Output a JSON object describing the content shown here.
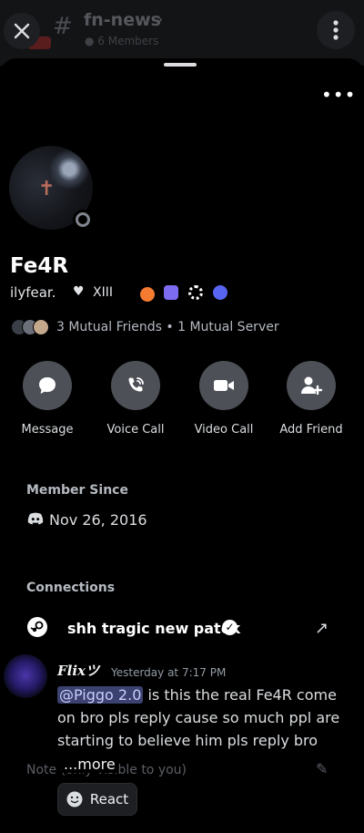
{
  "channel": {
    "hash_glyph": "#",
    "name": "fn-news",
    "chevron": "›",
    "member_count": "● 6 Members"
  },
  "sheet": {
    "more_glyph": "•••"
  },
  "profile": {
    "display_name": "Fe4R",
    "username": "ilyfear.",
    "heart_glyph": "♥",
    "clan_tag": "XIII",
    "mutual_text": "3 Mutual Friends  •  1 Mutual Server",
    "actions": [
      {
        "label": "Message",
        "icon": "message-bubble-icon"
      },
      {
        "label": "Voice Call",
        "icon": "phone-icon"
      },
      {
        "label": "Video Call",
        "icon": "video-camera-icon"
      },
      {
        "label": "Add Friend",
        "icon": "add-friend-icon"
      }
    ],
    "member_since_label": "Member Since",
    "member_since_date": "Nov 26, 2016",
    "connections_label": "Connections",
    "connection_name": "shh tragic new patek",
    "note_label": "Note (only visible to you)"
  },
  "message": {
    "author": "Flixツ",
    "timestamp": "Yesterday at 7:17 PM",
    "mention": "@Piggo 2.0",
    "body": " is this the real Fe4R come on bro pls reply cause so much ppl are starting to believe him pls reply bro",
    "more_label": "...more",
    "react_label": "React"
  },
  "colors": {
    "accent": "#5865f2",
    "button_bg": "#4e5058",
    "mention_bg": "#3c4270"
  }
}
